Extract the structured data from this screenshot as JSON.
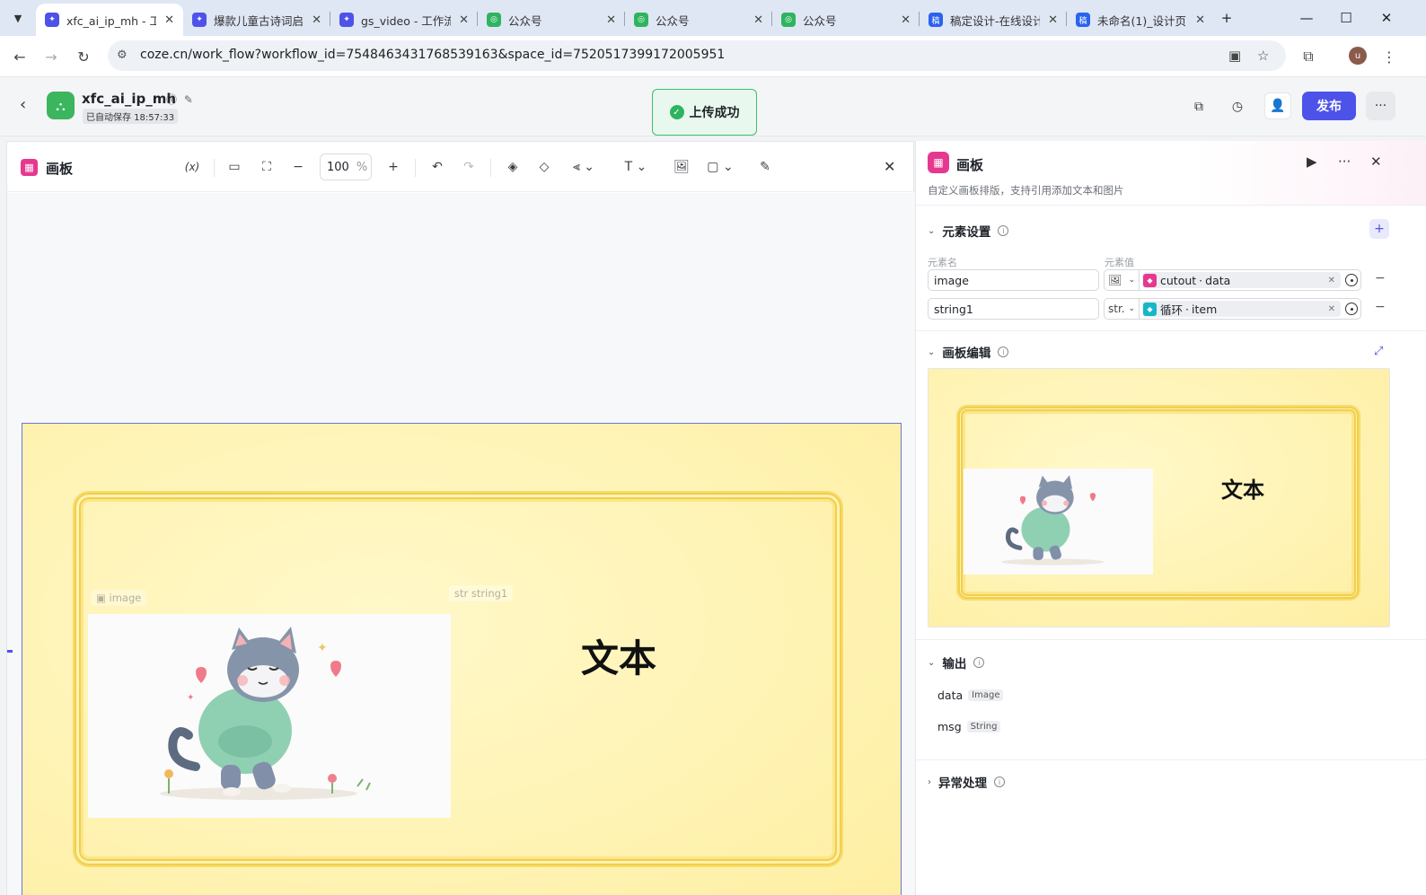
{
  "browser": {
    "tabs": [
      {
        "title": "xfc_ai_ip_mh - 工",
        "favicon_color": "#4d53e8",
        "favicon": "✦",
        "active": true
      },
      {
        "title": "爆款儿童古诗词启",
        "favicon_color": "#4d53e8",
        "favicon": "✦",
        "active": false
      },
      {
        "title": "gs_video - 工作流",
        "favicon_color": "#4d53e8",
        "favicon": "✦",
        "active": false
      },
      {
        "title": "公众号",
        "favicon_color": "#2eb45e",
        "favicon": "◎",
        "active": false
      },
      {
        "title": "公众号",
        "favicon_color": "#2eb45e",
        "favicon": "◎",
        "active": false
      },
      {
        "title": "公众号",
        "favicon_color": "#2eb45e",
        "favicon": "◎",
        "active": false
      },
      {
        "title": "稿定设计-在线设计",
        "favicon_color": "#2a62f0",
        "favicon": "稿",
        "active": false
      },
      {
        "title": "未命名(1)_设计页",
        "favicon_color": "#2a62f0",
        "favicon": "稿",
        "active": false
      }
    ],
    "url": "coze.cn/work_flow?workflow_id=7548463431768539163&space_id=7520517399172005951",
    "profile_initial": "u"
  },
  "app": {
    "name": "xfc_ai_ip_mh",
    "autosave": "已自动保存 18:57:33",
    "toast": "上传成功",
    "publish_label": "发布"
  },
  "editor": {
    "title": "画板",
    "zoom_value": "100",
    "zoom_unit": "%",
    "variable_btn": "(x)",
    "canvas": {
      "image_label": "image",
      "text_label": "string1",
      "text_label_prefix": "str",
      "text_content": "文本"
    }
  },
  "props": {
    "title": "画板",
    "description": "自定义画板排版，支持引用添加文本和图片",
    "elements_section": "元素设置",
    "col_name": "元素名",
    "col_value": "元素值",
    "rows": [
      {
        "name": "image",
        "type": "",
        "ref_source": "cutout",
        "ref_field": "data",
        "ref_color": "#e5398f"
      },
      {
        "name": "string1",
        "type": "str.",
        "ref_source": "循环",
        "ref_field": "item",
        "ref_color": "#16b7c9"
      }
    ],
    "board_section": "画板编辑",
    "preview_text": "文本",
    "output_section": "输出",
    "outputs": [
      {
        "name": "data",
        "type": "Image"
      },
      {
        "name": "msg",
        "type": "String"
      }
    ],
    "error_section": "异常处理"
  },
  "colors": {
    "brand": "#4d53e8",
    "success": "#2eb45e",
    "canvas_bg": "#fff3b3",
    "frame_gold": "#f1ce4c"
  }
}
